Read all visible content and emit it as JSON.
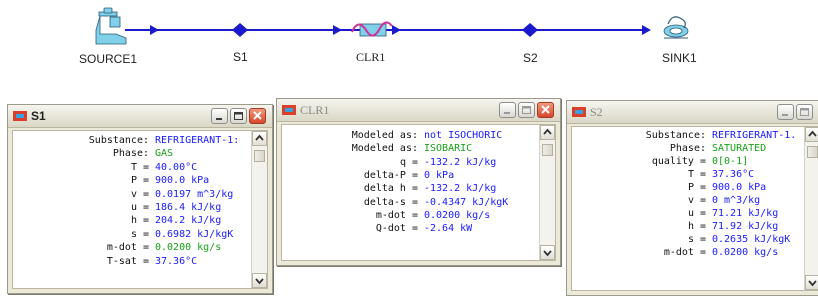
{
  "colors": {
    "stream": "#1a1acc",
    "node": "#1a1acc",
    "accent_blue": "#1a1aff",
    "accent_green": "#18a018",
    "close_red": "#d9462a"
  },
  "flowsheet": {
    "source": {
      "label": "SOURCE1",
      "icon": "faucet-icon"
    },
    "s1": {
      "label": "S1"
    },
    "clr1": {
      "label": "CLR1",
      "icon": "cooler-coil-icon"
    },
    "s2": {
      "label": "S2"
    },
    "sink": {
      "label": "SINK1",
      "icon": "sink-drain-icon"
    }
  },
  "windows": {
    "s1": {
      "title": "S1",
      "rows": [
        {
          "label": "Substance:",
          "value": "REFRIGERANT-1:"
        },
        {
          "label": "Phase:",
          "value": "GAS"
        },
        {
          "label": "T =",
          "value": "40.00°C"
        },
        {
          "label": "P =",
          "value": "900.0 kPa"
        },
        {
          "label": "v =",
          "value": "0.0197 m^3/kg"
        },
        {
          "label": "u =",
          "value": "186.4 kJ/kg"
        },
        {
          "label": "h =",
          "value": "204.2 kJ/kg"
        },
        {
          "label": "s =",
          "value": "0.6982 kJ/kgK"
        },
        {
          "label": "m-dot =",
          "value": "0.0200 kg/s"
        },
        {
          "label": "T-sat =",
          "value": "37.36°C"
        }
      ]
    },
    "clr1": {
      "title": "CLR1",
      "rows": [
        {
          "label": "Modeled as:",
          "value": "not ISOCHORIC"
        },
        {
          "label": "Modeled as:",
          "value": "ISOBARIC"
        },
        {
          "label": "q =",
          "value": "-132.2 kJ/kg"
        },
        {
          "label": "delta-P =",
          "value": "0 kPa"
        },
        {
          "label": "delta h =",
          "value": "-132.2 kJ/kg"
        },
        {
          "label": "delta-s =",
          "value": "-0.4347 kJ/kgK"
        },
        {
          "label": "m-dot =",
          "value": "0.0200 kg/s"
        },
        {
          "label": "Q-dot =",
          "value": "-2.64 kW"
        }
      ]
    },
    "s2": {
      "title": "S2",
      "rows": [
        {
          "label": "Substance:",
          "value": "REFRIGERANT-1."
        },
        {
          "label": "Phase:",
          "value": "SATURATED"
        },
        {
          "label": "quality =",
          "value": "0[0-1]"
        },
        {
          "label": "T =",
          "value": "37.36°C"
        },
        {
          "label": "P =",
          "value": "900.0 kPa"
        },
        {
          "label": "v =",
          "value": "0 m^3/kg"
        },
        {
          "label": "u =",
          "value": "71.21 kJ/kg"
        },
        {
          "label": "h =",
          "value": "71.92 kJ/kg"
        },
        {
          "label": "s =",
          "value": "0.2635 kJ/kgK"
        },
        {
          "label": "m-dot =",
          "value": "0.0200 kg/s"
        }
      ]
    }
  }
}
